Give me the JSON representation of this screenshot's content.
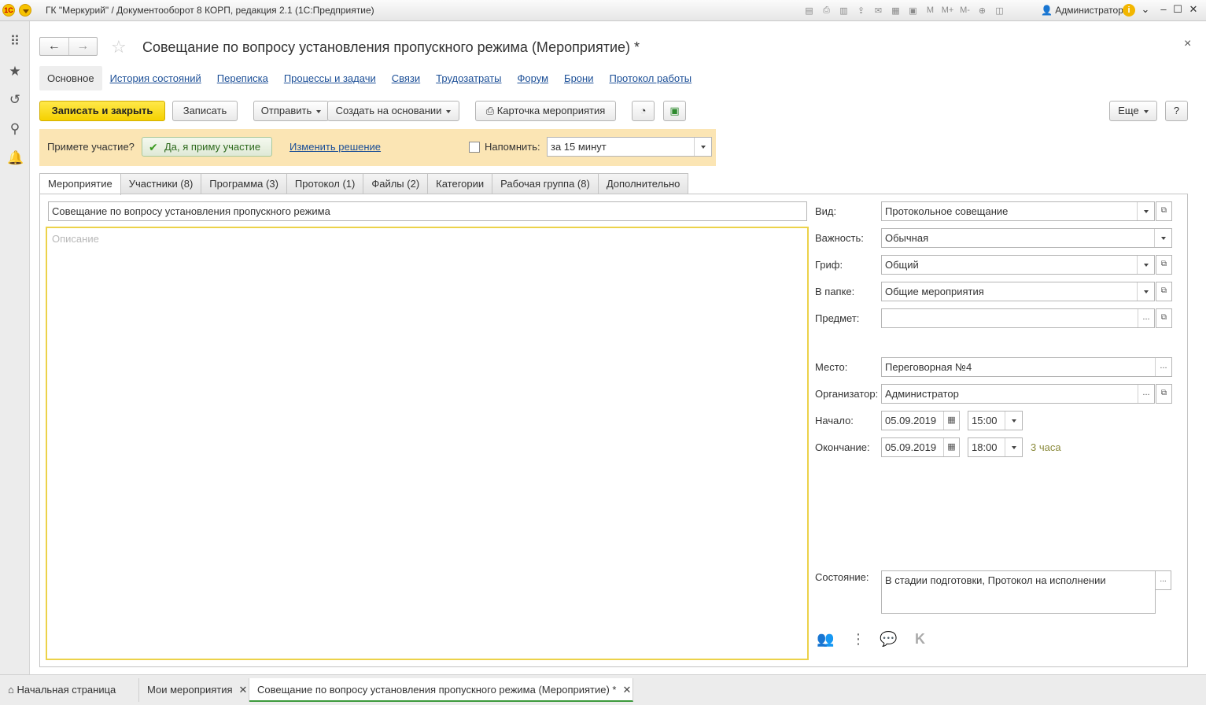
{
  "titlebar": {
    "title": "ГК \"Меркурий\" / Документооборот 8 КОРП, редакция 2.1  (1С:Предприятие)",
    "user": "Администратор",
    "m_labels": [
      "M",
      "M+",
      "M-"
    ]
  },
  "form": {
    "title": "Совещание по вопросу установления пропускного режима (Мероприятие) *",
    "close": "×"
  },
  "top_tabs": [
    "Основное",
    "История состояний",
    "Переписка",
    "Процессы и задачи",
    "Связи",
    "Трудозатраты",
    "Форум",
    "Брони",
    "Протокол работы"
  ],
  "toolbar": {
    "save_close": "Записать и закрыть",
    "save": "Записать",
    "send": "Отправить",
    "create_based": "Создать на основании",
    "event_card": "Карточка мероприятия",
    "more": "Еще",
    "help": "?"
  },
  "participation": {
    "question": "Примете участие?",
    "accept": "Да, я приму участие",
    "change": "Изменить решение",
    "remind_label": "Напомнить:",
    "remind_value": "за 15 минут"
  },
  "content_tabs": [
    "Мероприятие",
    "Участники (8)",
    "Программа (3)",
    "Протокол (1)",
    "Файлы (2)",
    "Категории",
    "Рабочая группа (8)",
    "Дополнительно"
  ],
  "event": {
    "subject": "Совещание по вопросу установления пропускного режима",
    "description_placeholder": "Описание"
  },
  "fields": {
    "vid_label": "Вид:",
    "vid_value": "Протокольное совещание",
    "importance_label": "Важность:",
    "importance_value": "Обычная",
    "grif_label": "Гриф:",
    "grif_value": "Общий",
    "folder_label": "В папке:",
    "folder_value": "Общие мероприятия",
    "subject_label": "Предмет:",
    "subject_value": "",
    "place_label": "Место:",
    "place_value": "Переговорная №4",
    "organizer_label": "Организатор:",
    "organizer_value": "Администратор",
    "start_label": "Начало:",
    "start_date": "05.09.2019",
    "start_time": "15:00",
    "end_label": "Окончание:",
    "end_date": "05.09.2019",
    "end_time": "18:00",
    "duration": "3 часа",
    "state_label": "Состояние:",
    "state_value": "В стадии подготовки, Протокол на исполнении"
  },
  "bottom_tabs": {
    "home": "Начальная страница",
    "my_events": "Мои мероприятия",
    "current": "Совещание по вопросу установления пропускного режима (Мероприятие) *"
  }
}
